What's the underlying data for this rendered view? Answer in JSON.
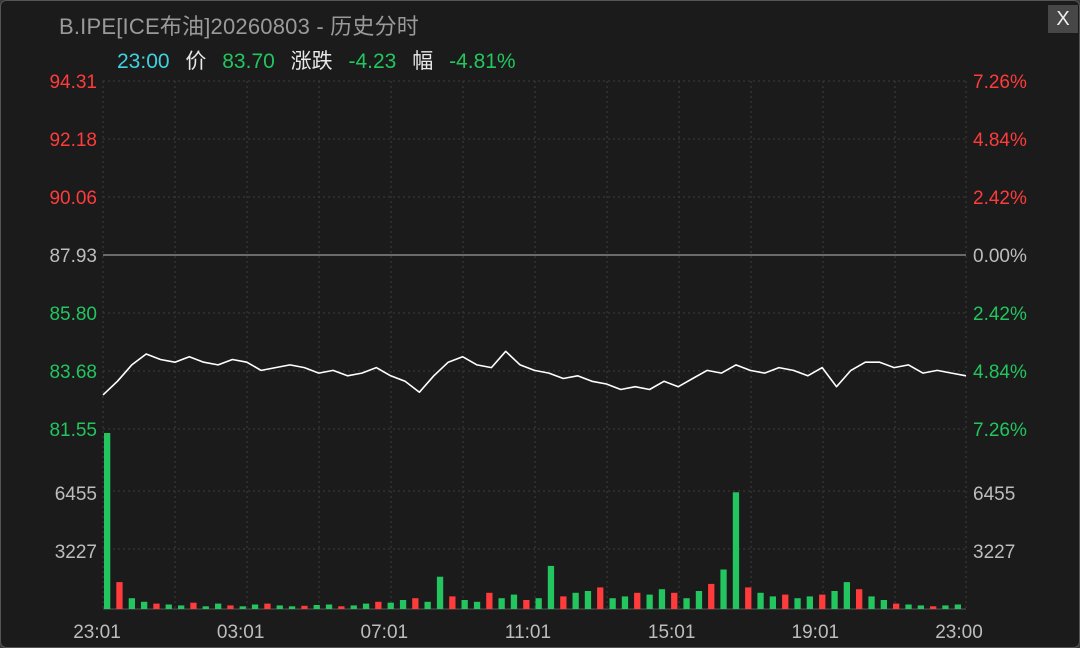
{
  "title": "B.IPE[ICE布油]20260803 - 历史分时",
  "close_label": "X",
  "info": {
    "time": "23:00",
    "price_label": "价",
    "price": "83.70",
    "change_label": "涨跌",
    "change": "-4.23",
    "pct_label": "幅",
    "pct": "-4.81%"
  },
  "colors": {
    "up": "#ff3b3b",
    "down": "#22c55e",
    "neutral": "#bdbdbd",
    "line": "#ffffff",
    "time": "#3fd1e0"
  },
  "chart_data": [
    {
      "type": "line",
      "series": [
        {
          "name": "",
          "values": [
            82.8,
            83.3,
            83.9,
            84.3,
            84.1,
            84.0,
            84.2,
            84.0,
            83.9,
            84.1,
            84.0,
            83.7,
            83.8,
            83.9,
            83.8,
            83.6,
            83.7,
            83.5,
            83.6,
            83.8,
            83.5,
            83.3,
            82.9,
            83.5,
            84.0,
            84.2,
            83.9,
            83.8,
            84.4,
            83.9,
            83.7,
            83.6,
            83.4,
            83.5,
            83.3,
            83.2,
            83.0,
            83.1,
            83.0,
            83.3,
            83.1,
            83.4,
            83.7,
            83.6,
            83.9,
            83.7,
            83.6,
            83.8,
            83.7,
            83.5,
            83.8,
            83.1,
            83.7,
            84.0,
            84.0,
            83.8,
            83.9,
            83.6,
            83.7,
            83.6,
            83.5
          ]
        }
      ],
      "x_start": "23:01",
      "x_end": "23:00",
      "x_ticks": [
        "23:01",
        "03:01",
        "07:01",
        "11:01",
        "15:01",
        "19:01",
        "23:00"
      ],
      "y_ticks_left": [
        "94.31",
        "92.18",
        "90.06",
        "87.93",
        "85.80",
        "83.68",
        "81.55"
      ],
      "y_ticks_right": [
        "7.26%",
        "4.84%",
        "2.42%",
        "0.00%",
        "2.42%",
        "4.84%",
        "7.26%"
      ],
      "ylim": [
        81.55,
        94.31
      ],
      "reference": 87.93
    },
    {
      "type": "bar",
      "series": [
        {
          "name": "",
          "values": [
            9800,
            1500,
            600,
            400,
            300,
            250,
            200,
            350,
            150,
            300,
            200,
            150,
            250,
            300,
            200,
            150,
            180,
            220,
            250,
            150,
            200,
            300,
            400,
            350,
            500,
            600,
            400,
            1800,
            700,
            500,
            400,
            900,
            600,
            800,
            500,
            600,
            2400,
            700,
            900,
            1000,
            1200,
            600,
            700,
            900,
            800,
            1100,
            900,
            600,
            1000,
            1400,
            2200,
            6500,
            1200,
            900,
            700,
            800,
            600,
            700,
            800,
            1000,
            1500,
            1100,
            700,
            500,
            300,
            250,
            200,
            150,
            200,
            250
          ]
        }
      ],
      "y_ticks": [
        "6455",
        "3227"
      ],
      "ylim": [
        0,
        9800
      ]
    }
  ]
}
